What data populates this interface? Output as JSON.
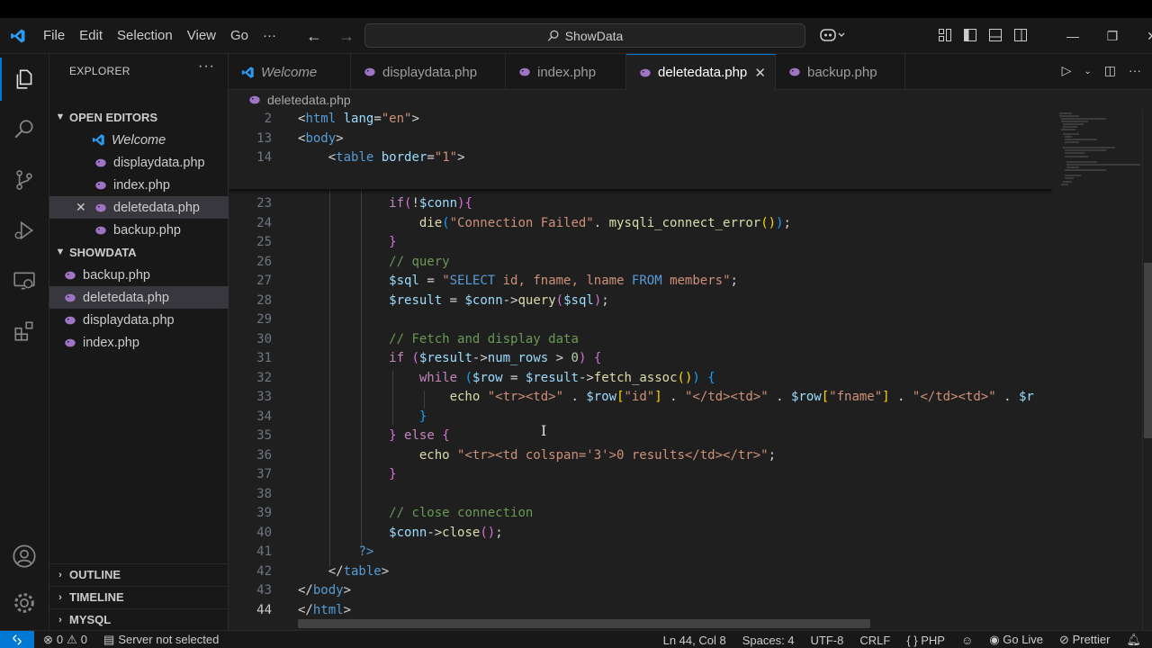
{
  "menu": [
    "File",
    "Edit",
    "Selection",
    "View",
    "Go",
    "···"
  ],
  "command_center": "ShowData",
  "sidebar": {
    "title": "EXPLORER",
    "open_editors_label": "OPEN EDITORS",
    "open_editors": [
      {
        "label": "Welcome",
        "icon": "vscode-icon"
      },
      {
        "label": "displaydata.php",
        "icon": "php-icon"
      },
      {
        "label": "index.php",
        "icon": "php-icon"
      },
      {
        "label": "deletedata.php",
        "icon": "php-icon",
        "selected": true
      },
      {
        "label": "backup.php",
        "icon": "php-icon"
      }
    ],
    "folder_label": "SHOWDATA",
    "files": [
      "backup.php",
      "deletedata.php",
      "displaydata.php",
      "index.php"
    ],
    "outline_label": "OUTLINE",
    "timeline_label": "TIMELINE",
    "mysql_label": "MYSQL"
  },
  "tabs": [
    {
      "label": "Welcome"
    },
    {
      "label": "displaydata.php"
    },
    {
      "label": "index.php"
    },
    {
      "label": "deletedata.php",
      "active": true
    },
    {
      "label": "backup.php"
    }
  ],
  "breadcrumb": "deletedata.php",
  "line_numbers": [
    "2",
    "13",
    "14",
    "23",
    "24",
    "25",
    "26",
    "27",
    "28",
    "29",
    "30",
    "31",
    "32",
    "33",
    "34",
    "35",
    "36",
    "37",
    "38",
    "39",
    "40",
    "41",
    "42",
    "43",
    "44"
  ],
  "status": {
    "errors": "0",
    "warnings": "0",
    "server": "Server not selected",
    "position": "Ln 44, Col 8",
    "spaces": "Spaces: 4",
    "encoding": "UTF-8",
    "eol": "CRLF",
    "language": "PHP",
    "golive": "Go Live",
    "prettier": "Prettier"
  },
  "colors": {
    "accent": "#0078d4",
    "background": "#1f1f1f",
    "php_icon": "#a074c4"
  }
}
